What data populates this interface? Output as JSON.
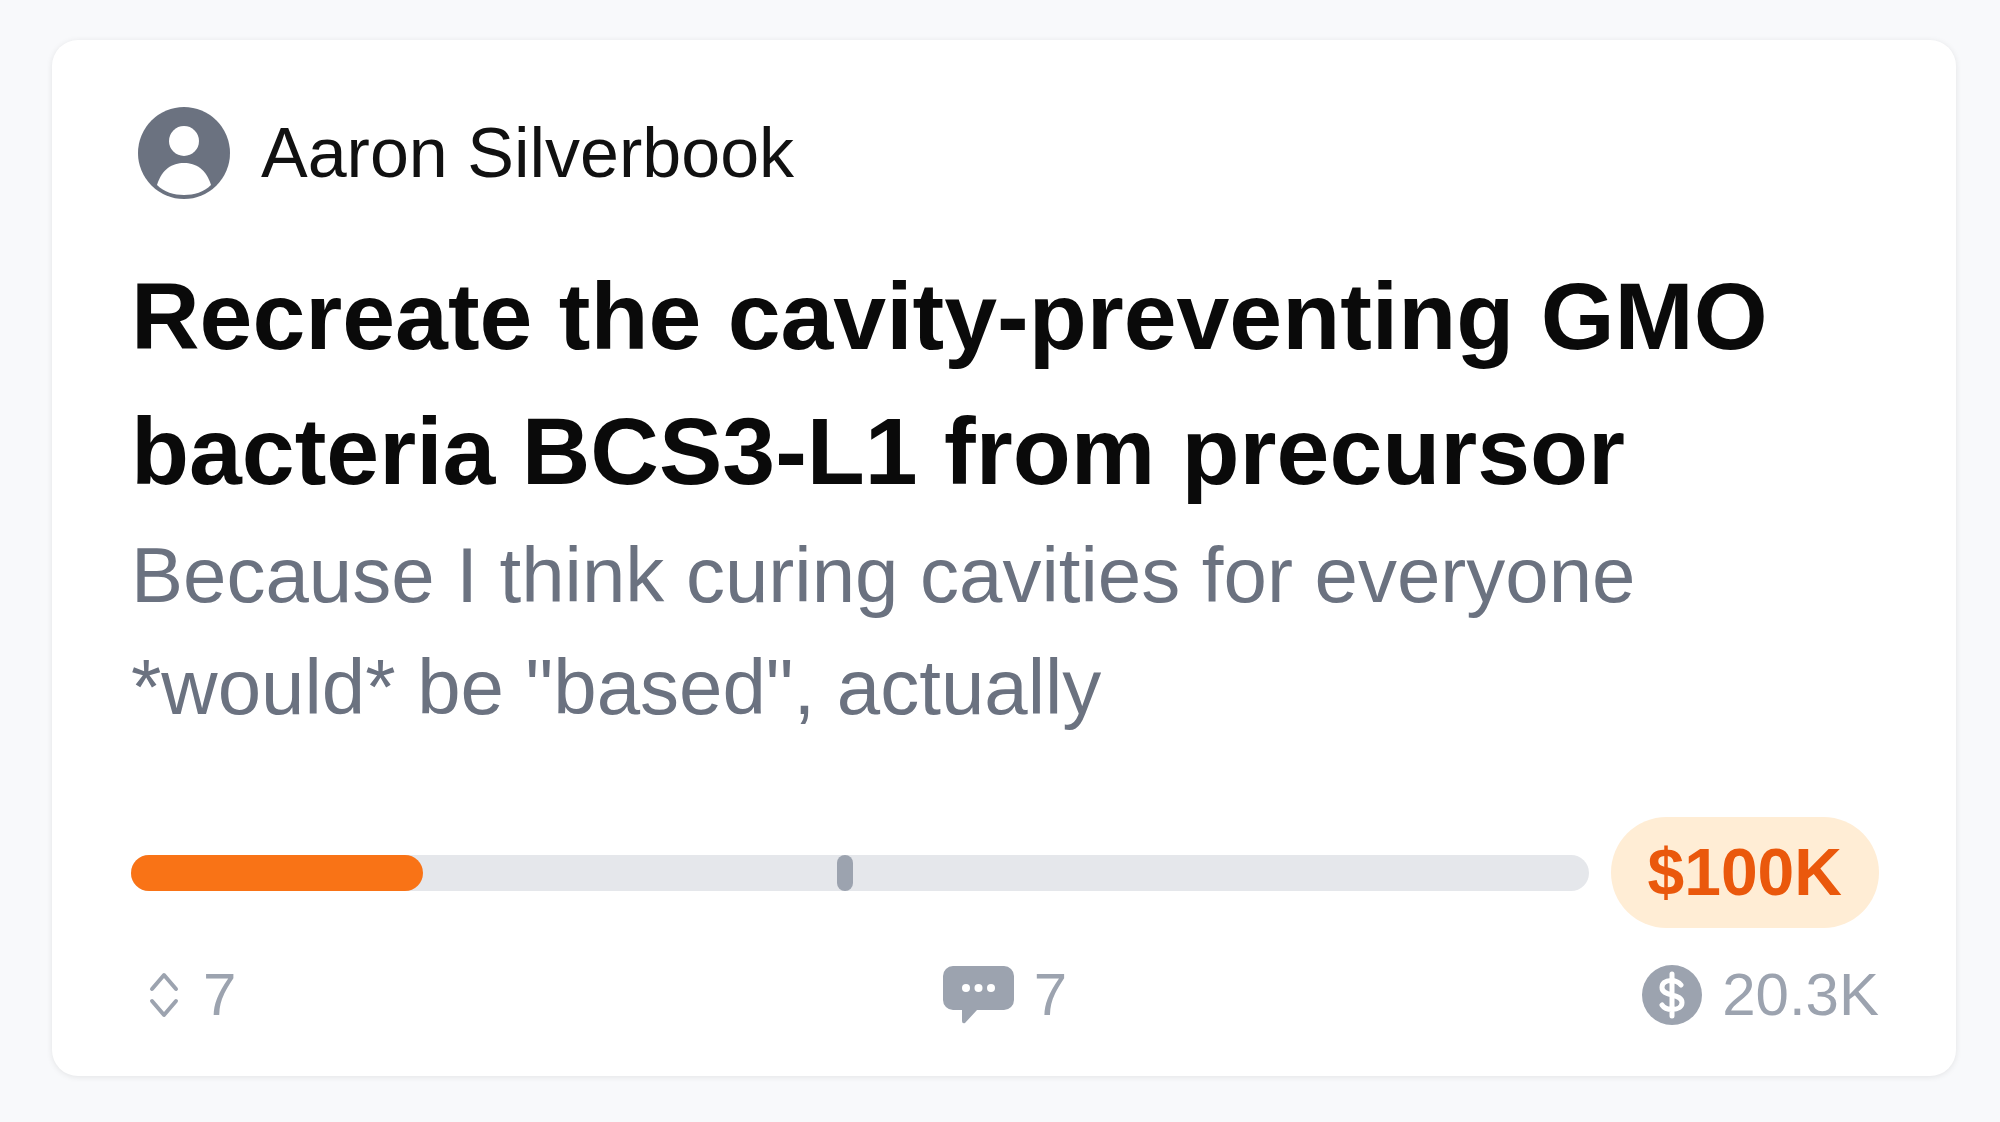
{
  "author": {
    "name": "Aaron Silverbook"
  },
  "title": "Recreate the cavity-preventing GMO bacteria BCS3-L1 from precursor",
  "description": "Because I think curing cavities for everyone *would* be \"based\", actually",
  "progress": {
    "level": 0.2,
    "marker": {
      "level": 0.49
    },
    "goal": "$100K"
  },
  "stats": [
    {
      "kind": "votes",
      "value": "7"
    },
    {
      "kind": "comments",
      "value": "7"
    },
    {
      "kind": "funding",
      "value": "20.3K"
    }
  ]
}
